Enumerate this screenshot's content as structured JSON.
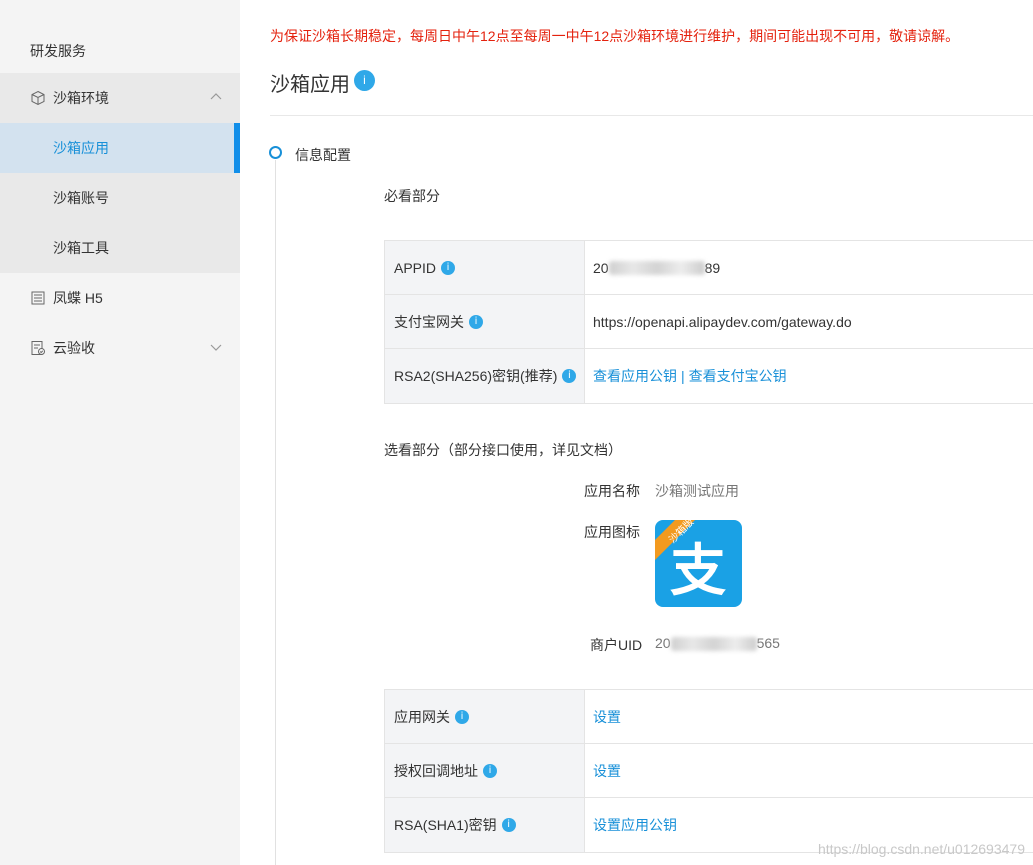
{
  "sidebar": {
    "section_title": "研发服务",
    "sandbox_group": {
      "label": "沙箱环境",
      "sub_items": [
        {
          "label": "沙箱应用",
          "active": true
        },
        {
          "label": "沙箱账号",
          "active": false
        },
        {
          "label": "沙箱工具",
          "active": false
        }
      ]
    },
    "h5_item": {
      "label": "凤蝶 H5"
    },
    "cloud_item": {
      "label": "云验收"
    }
  },
  "notice": "为保证沙箱长期稳定，每周日中午12点至每周一中午12点沙箱环境进行维护，期间可能出现不可用，敬请谅解。",
  "page": {
    "title": "沙箱应用",
    "title_badge": "i"
  },
  "step": {
    "label": "信息配置"
  },
  "required": {
    "title": "必看部分",
    "rows": [
      {
        "key": "APPID",
        "value_prefix": "20",
        "value_suffix": "89",
        "type": "text"
      },
      {
        "key": "支付宝网关",
        "value": "https://openapi.alipaydev.com/gateway.do",
        "type": "text"
      },
      {
        "key": "RSA2(SHA256)密钥(推荐)",
        "links": [
          "查看应用公钥",
          "|",
          "查看支付宝公钥"
        ],
        "type": "links"
      }
    ]
  },
  "optional": {
    "title": "选看部分（部分接口使用，详见文档）",
    "app_name_label": "应用名称",
    "app_name_value": "沙箱测试应用",
    "app_icon_label": "应用图标",
    "app_icon_ribbon": "沙箱版",
    "app_icon_glyph": "支",
    "merchant_label": "商户UID",
    "merchant_value_prefix": "20",
    "merchant_value_suffix": "565",
    "rows": [
      {
        "key": "应用网关",
        "link": "设置"
      },
      {
        "key": "授权回调地址",
        "link": "设置"
      },
      {
        "key": "RSA(SHA1)密钥",
        "link": "设置应用公钥"
      }
    ]
  },
  "info_badge": "i",
  "watermark": "https://blog.csdn.net/u012693479",
  "colors": {
    "accent": "#1890d8",
    "notice": "#e4220e",
    "alipay_blue": "#1aa1e5",
    "ribbon": "#f39a1f"
  }
}
